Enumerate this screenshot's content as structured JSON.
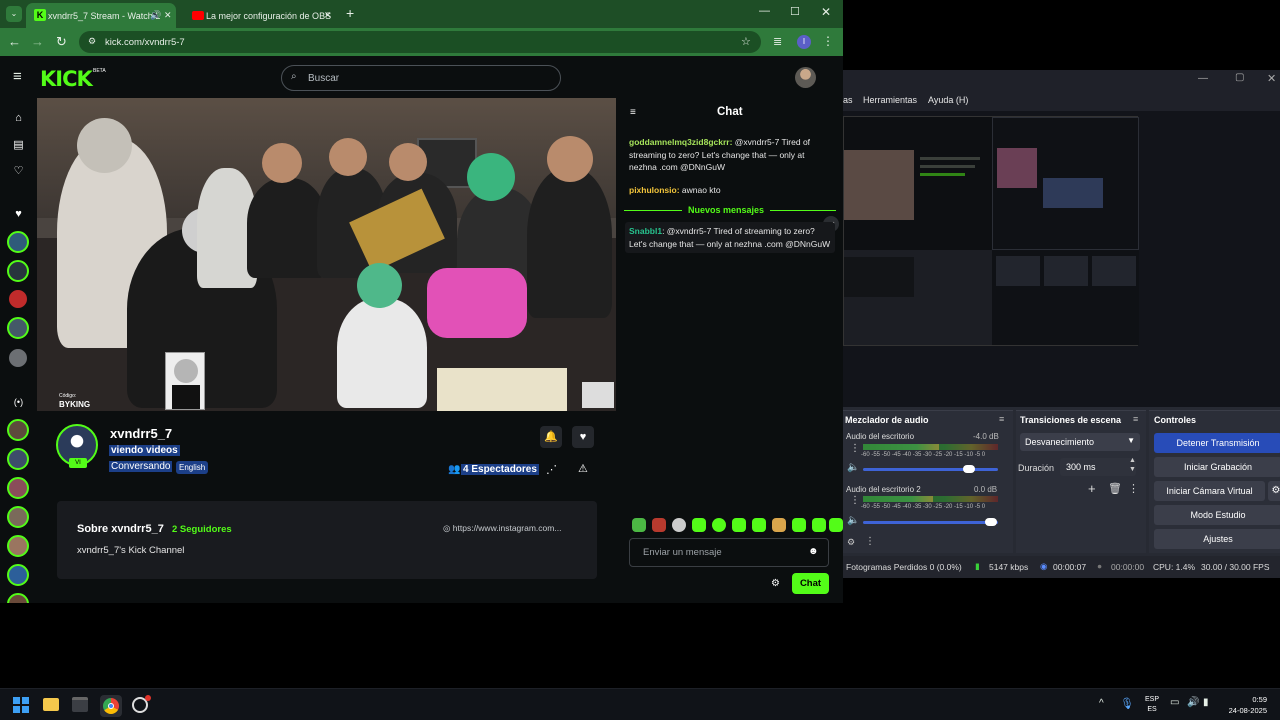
{
  "browser": {
    "tabs": [
      {
        "title": "xvndrr5_7 Stream - Watch L",
        "active": true
      },
      {
        "title": "La mejor configuración de OBS",
        "active": false
      }
    ],
    "new_tab": "+",
    "url": "kick.com/xvndrr5-7",
    "profile_initial": "I"
  },
  "kick": {
    "logo": "KICK",
    "logo_badge": "BETA",
    "search_placeholder": "Buscar",
    "streamer": {
      "name": "xvndrr5_7",
      "title": "viendo videos",
      "category": "Conversando",
      "language": "English",
      "viewers": "4 Espectadores",
      "avatar_badge": "VI"
    },
    "about": {
      "heading": "Sobre xvndrr5_7",
      "followers": "2 Seguidores",
      "link": "https://www.instagram.com...",
      "bio": "xvndrr5_7's Kick Channel"
    },
    "video_overlay": {
      "code_label": "Código:",
      "code": "BYKING"
    }
  },
  "chat": {
    "title": "Chat",
    "messages": [
      {
        "user": "goddamnelmq3zid8gckrr:",
        "user_color": "#a6e35b",
        "text": " @xvndrr5-7 Tired of streaming to zero? Let's change that — only at nezhna .com @DNnGuW"
      },
      {
        "user": "pixhulonsio:",
        "user_color": "#f3c53b",
        "text": " awnao kto"
      }
    ],
    "new_messages_divider": "Nuevos mensajes",
    "new_message": {
      "user": "Snabbl1",
      "user_color": "#27c48f",
      "text": ": @xvndrr5-7 Tired of streaming to zero? Let's change that — only at nezhna .com @DNnGuW"
    },
    "input_placeholder": "Enviar un mensaje",
    "send_label": "Chat"
  },
  "obs": {
    "menu": [
      "as",
      "Herramientas",
      "Ayuda (H)"
    ],
    "audio_mixer": {
      "title": "Mezclador de audio",
      "tracks": [
        {
          "name": "Audio del escritorio",
          "db": "-4.0 dB",
          "level": 0.56
        },
        {
          "name": "Audio del escritorio 2",
          "db": "0.0 dB",
          "level": 0.52
        }
      ],
      "scale": "-60 -55 -50 -45 -40 -35 -30 -25 -20 -15 -10 -5 0"
    },
    "transitions": {
      "title": "Transiciones de escena",
      "selected": "Desvanecimiento",
      "duration_label": "Duración",
      "duration": "300 ms"
    },
    "controls": {
      "title": "Controles",
      "buttons": [
        "Detener Transmisión",
        "Iniciar Grabación",
        "Iniciar Cámara Virtual",
        "Modo Estudio",
        "Ajustes"
      ]
    },
    "status": {
      "dropped": "Fotogramas Perdidos 0 (0.0%)",
      "bitrate": "5147 kbps",
      "stream_time": "00:00:07",
      "rec_time": "00:00:00",
      "cpu": "CPU: 1.4%",
      "fps": "30.00 / 30.00 FPS"
    }
  },
  "taskbar": {
    "lang_top": "ESP",
    "lang_bottom": "ES",
    "time": "0:59",
    "date": "24-08-2025"
  },
  "colors": {
    "kick_green": "#53fc18",
    "chrome_tab": "#2f7a3b",
    "obs_primary": "#284cb8"
  }
}
